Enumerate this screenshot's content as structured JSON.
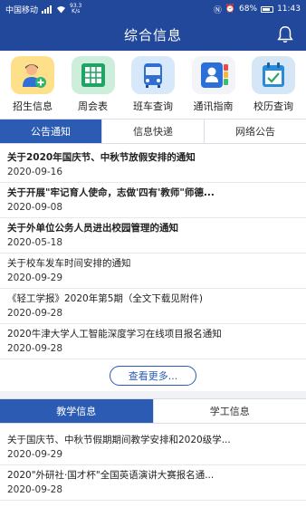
{
  "status": {
    "carrier": "中国移动",
    "speed_value": "93.3",
    "speed_unit": "K/s",
    "battery": "68%",
    "time": "11:43"
  },
  "header": {
    "title": "综合信息",
    "bell_icon": "bell-icon"
  },
  "quick": [
    {
      "label": "招生信息",
      "icon": "admission-icon"
    },
    {
      "label": "周会表",
      "icon": "spreadsheet-icon"
    },
    {
      "label": "班车查询",
      "icon": "bus-icon"
    },
    {
      "label": "通讯指南",
      "icon": "contacts-icon"
    },
    {
      "label": "校历查询",
      "icon": "calendar-icon"
    }
  ],
  "tabs_notice": [
    {
      "label": "公告通知",
      "active": true
    },
    {
      "label": "信息快递",
      "active": false
    },
    {
      "label": "网络公告",
      "active": false
    }
  ],
  "notices": [
    {
      "title": "关于2020年国庆节、中秋节放假安排的通知",
      "date": "2020-09-16",
      "bold": true
    },
    {
      "title": "关于开展\"牢记育人使命，志做'四有'教师\"师德...",
      "date": "2020-09-08",
      "bold": true
    },
    {
      "title": "关于外单位公务人员进出校园管理的通知",
      "date": "2020-05-18",
      "bold": true
    },
    {
      "title": "关于校车发车时间安排的通知",
      "date": "2020-09-29",
      "bold": false
    },
    {
      "title": "《轻工学报》2020年第5期（全文下载见附件)",
      "date": "2020-09-28",
      "bold": false
    },
    {
      "title": "2020牛津大学人工智能深度学习在线项目报名通知",
      "date": "2020-09-28",
      "bold": false
    }
  ],
  "more_label": "查看更多...",
  "tabs_teaching": [
    {
      "label": "教学信息",
      "active": true
    },
    {
      "label": "学工信息",
      "active": false
    }
  ],
  "teaching": [
    {
      "title": "关于国庆节、中秋节假期期间教学安排和2020级学...",
      "date": "2020-09-29"
    },
    {
      "title": "2020\"外研社·国才杯\"全国英语演讲大赛报名通...",
      "date": "2020-09-28"
    }
  ],
  "colors": {
    "primary": "#22489b",
    "tab_active": "#2b5bb3"
  }
}
